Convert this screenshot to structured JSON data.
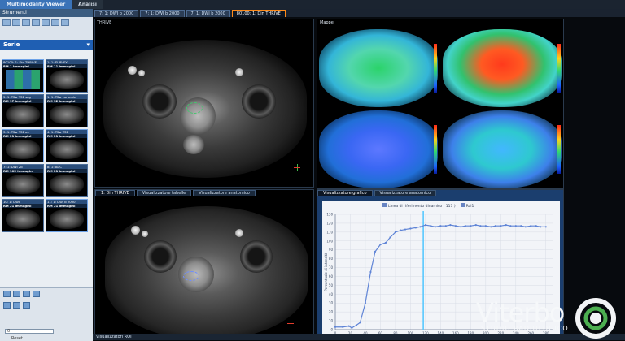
{
  "app": {
    "tabs": [
      {
        "label": "Multimodality Viewer",
        "active": true
      },
      {
        "label": "Analisi",
        "active": false
      }
    ]
  },
  "left_panel": {
    "title": "Strumenti",
    "series_title": "Serie",
    "series": [
      {
        "name": "80100: 1: Din THRIVE",
        "count": "RM 1 immagini",
        "selected": true
      },
      {
        "name": "1: 1: SURVEY",
        "count": "RM 11 immagini"
      },
      {
        "name": "5: 1: T2w TSE sag",
        "count": "RM 17 immagini"
      },
      {
        "name": "1: 1: T2w coronale",
        "count": "RM 32 immagini"
      },
      {
        "name": "3: 1: T2w TSE ax",
        "count": "RM 21 immagini"
      },
      {
        "name": "4: 1: T2w TSE",
        "count": "RM 21 immagini"
      },
      {
        "name": "7: 1: DWI 2b",
        "count": "RM 105 immagini"
      },
      {
        "name": "8: 1: ADC",
        "count": "RM 21 immagini"
      },
      {
        "name": "10: 1: DWI",
        "count": "RM 21 immagini"
      },
      {
        "name": "11: 1: DWI b 2000",
        "count": "RM 21 immagini"
      }
    ],
    "slider_value": "0",
    "reset_label": "Reset"
  },
  "viewer": {
    "tabs": [
      {
        "label": "7: 1: DWI b 2000",
        "active": false
      },
      {
        "label": "7: 1: DWI b 2000",
        "active": false
      },
      {
        "label": "7: 1: DWI b 2000",
        "active": false
      },
      {
        "label": "80100: 1: Din THRIVE",
        "active": true
      }
    ],
    "top_left_label": "THRIVE",
    "maps_title": "Mappe",
    "lower_left_tabs": [
      "1: Din THRIVE",
      "Visualizzatore tabelle",
      "Visualizzatore anatomico"
    ],
    "lower_right_tabs": [
      "Visualizzatore grafico",
      "Visualizzatore anatomico"
    ],
    "bottom_label": "Visualizzatori ROI"
  },
  "chart_data": {
    "type": "line",
    "legend": [
      "Linea di riferimento dinamico ( 117 )",
      "Roi1"
    ],
    "ylabel": "Percentuale di intensità",
    "x_ticks": [
      0,
      20,
      40,
      60,
      80,
      100,
      120,
      140,
      160,
      180,
      200,
      220,
      240,
      260,
      280
    ],
    "y_ticks": [
      0,
      10,
      20,
      30,
      40,
      50,
      60,
      70,
      80,
      90,
      100,
      110,
      120,
      130
    ],
    "xlim": [
      0,
      290
    ],
    "ylim": [
      0,
      130
    ],
    "reference_line_x": 117,
    "series": [
      {
        "name": "Roi1",
        "color": "#5f84d6",
        "x": [
          0,
          10,
          18,
          22,
          28,
          33,
          40,
          47,
          53,
          60,
          67,
          73,
          80,
          87,
          93,
          100,
          107,
          113,
          120,
          127,
          133,
          140,
          147,
          153,
          160,
          167,
          173,
          180,
          187,
          193,
          200,
          207,
          213,
          220,
          227,
          233,
          240,
          247,
          253,
          260,
          267,
          273,
          280
        ],
        "y": [
          3,
          3,
          4,
          2,
          5,
          8,
          30,
          65,
          88,
          96,
          98,
          104,
          110,
          112,
          113,
          114,
          115,
          116,
          118,
          117,
          116,
          117,
          117,
          118,
          117,
          116,
          117,
          117,
          118,
          117,
          117,
          116,
          117,
          117,
          118,
          117,
          117,
          117,
          116,
          117,
          117,
          116,
          116
        ]
      }
    ]
  },
  "watermark": {
    "title": "Viterbo",
    "subtitle": "STUDIO RADIOLOGICO"
  },
  "colors": {
    "accent": "#ff8b1a",
    "brand": "#1f5fb3"
  }
}
